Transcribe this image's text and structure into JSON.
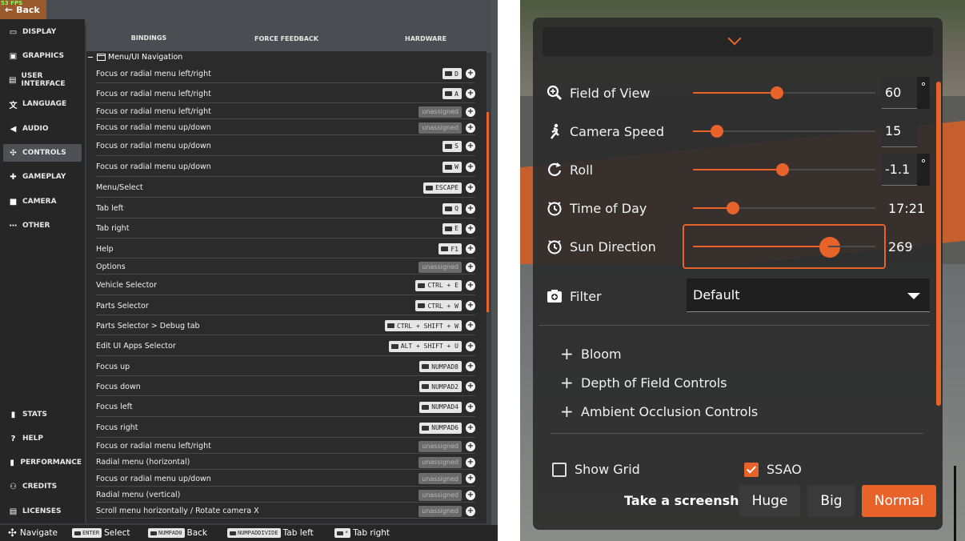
{
  "left": {
    "fps": "53 FPS",
    "back_label": "Back",
    "nav_top": [
      {
        "icon": "display-icon",
        "label": "DISPLAY",
        "active": false
      },
      {
        "icon": "graphics-icon",
        "label": "GRAPHICS",
        "active": false
      },
      {
        "icon": "user-interface-icon",
        "label": "USER INTERFACE",
        "active": false
      },
      {
        "icon": "language-icon",
        "label": "LANGUAGE",
        "active": false
      },
      {
        "icon": "audio-icon",
        "label": "AUDIO",
        "active": false
      },
      {
        "icon": "controls-icon",
        "label": "CONTROLS",
        "active": true
      },
      {
        "icon": "gameplay-icon",
        "label": "GAMEPLAY",
        "active": false
      },
      {
        "icon": "camera-icon",
        "label": "CAMERA",
        "active": false
      },
      {
        "icon": "more-icon",
        "label": "OTHER",
        "active": false
      }
    ],
    "nav_bottom": [
      {
        "icon": "stats-icon",
        "label": "STATS"
      },
      {
        "icon": "help-icon",
        "label": "HELP"
      },
      {
        "icon": "performance-icon",
        "label": "PERFORMANCE"
      },
      {
        "icon": "credits-icon",
        "label": "CREDITS"
      },
      {
        "icon": "licenses-icon",
        "label": "LICENSES"
      }
    ],
    "tabs": [
      {
        "label": "BINDINGS",
        "active": true
      },
      {
        "label": "FORCE FEEDBACK",
        "active": false
      },
      {
        "label": "HARDWARE",
        "active": false
      }
    ],
    "group_title": "Menu/UI Navigation",
    "bindings": [
      {
        "action": "Focus or radial menu left/right",
        "key": "D"
      },
      {
        "action": "Focus or radial menu left/right",
        "key": "A"
      },
      {
        "action": "Focus or radial menu left/right",
        "key": "unassigned"
      },
      {
        "action": "Focus or radial menu up/down",
        "key": "unassigned"
      },
      {
        "action": "Focus or radial menu up/down",
        "key": "S"
      },
      {
        "action": "Focus or radial menu up/down",
        "key": "W"
      },
      {
        "action": "Menu/Select",
        "key": "ESCAPE"
      },
      {
        "action": "Tab left",
        "key": "Q"
      },
      {
        "action": "Tab right",
        "key": "E"
      },
      {
        "action": "Help",
        "key": "F1"
      },
      {
        "action": "Options",
        "key": "unassigned"
      },
      {
        "action": "Vehicle Selector",
        "key": "CTRL + E"
      },
      {
        "action": "Parts Selector",
        "key": "CTRL + W"
      },
      {
        "action": "Parts Selector > Debug tab",
        "key": "CTRL + SHIFT + W"
      },
      {
        "action": "Edit UI Apps Selector",
        "key": "ALT + SHIFT + U"
      },
      {
        "action": "Focus up",
        "key": "NUMPAD8"
      },
      {
        "action": "Focus down",
        "key": "NUMPAD2"
      },
      {
        "action": "Focus left",
        "key": "NUMPAD4"
      },
      {
        "action": "Focus right",
        "key": "NUMPAD6"
      },
      {
        "action": "Focus or radial menu left/right",
        "key": "unassigned"
      },
      {
        "action": "Radial menu (horizontal)",
        "key": "unassigned"
      },
      {
        "action": "Focus or radial menu up/down",
        "key": "unassigned"
      },
      {
        "action": "Radial menu (vertical)",
        "key": "unassigned"
      },
      {
        "action": "Scroll menu horizontally / Rotate camera X",
        "key": "unassigned"
      }
    ],
    "footer": [
      {
        "key": "",
        "label": "Navigate",
        "icon": "dpad-icon"
      },
      {
        "key": "ENTER",
        "label": "Select"
      },
      {
        "key": "NUMPAD0",
        "label": "Back"
      },
      {
        "key": "NUMPADDIVIDE",
        "label": "Tab left"
      },
      {
        "key": "*",
        "label": "Tab right"
      }
    ]
  },
  "right": {
    "sliders": [
      {
        "icon": "zoom-icon",
        "label": "Field of View",
        "value": "60",
        "unit": "°",
        "fraction": 0.46,
        "editable": true
      },
      {
        "icon": "running-icon",
        "label": "Camera Speed",
        "value": "15",
        "unit": "",
        "fraction": 0.13,
        "editable": true
      },
      {
        "icon": "rotate-icon",
        "label": "Roll",
        "value": "-1.1",
        "unit": "°",
        "fraction": 0.49,
        "editable": true
      },
      {
        "icon": "clock-icon",
        "label": "Time of Day",
        "value": "17:21",
        "unit": "",
        "fraction": 0.22,
        "editable": false
      },
      {
        "icon": "sun-direction-icon",
        "label": "Sun Direction",
        "value": "269",
        "unit": "",
        "fraction": 0.74,
        "editable": false
      }
    ],
    "filter_label": "Filter",
    "filter_value": "Default",
    "expanders": [
      "Bloom",
      "Depth of Field Controls",
      "Ambient Occlusion Controls"
    ],
    "show_grid": {
      "label": "Show Grid",
      "checked": false
    },
    "ssao": {
      "label": "SSAO",
      "checked": true
    },
    "screenshot_label": "Take a screenshot:",
    "screenshot_buttons": [
      {
        "label": "Huge",
        "active": false
      },
      {
        "label": "Big",
        "active": false
      },
      {
        "label": "Normal",
        "active": true
      }
    ],
    "colors": {
      "accent": "#e8632a",
      "panel": "#2c2c2c"
    }
  }
}
